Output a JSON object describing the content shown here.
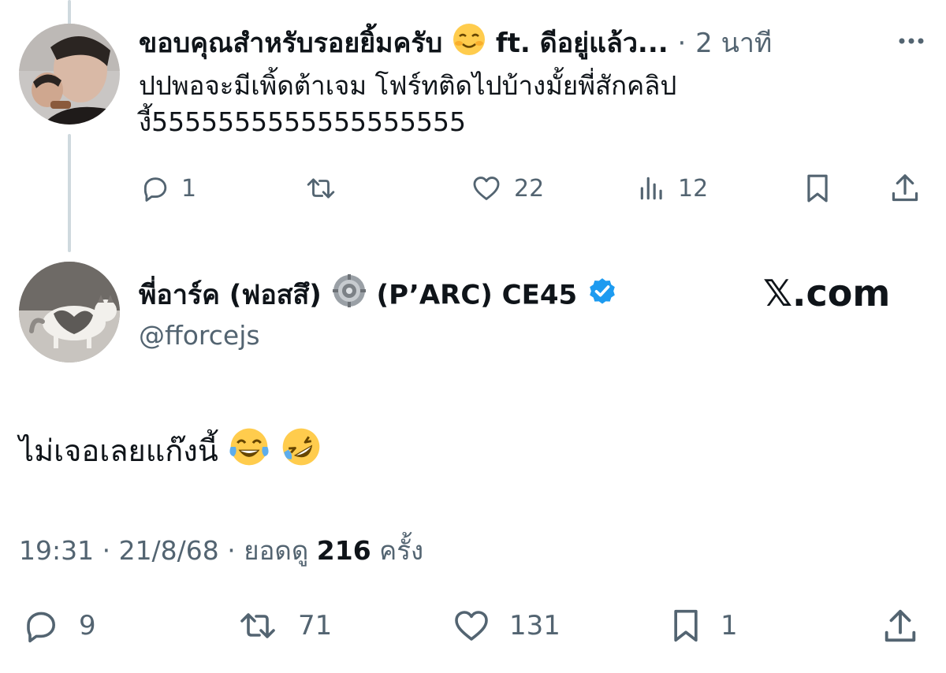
{
  "reply_tweet": {
    "display_name": "ขอบคุณสำหรับรอยยิ้มครับ",
    "name_suffix": "ft. ดีอยู่แล้ว...",
    "separator": "·",
    "time_ago": "2 นาที",
    "more_icon": "more-icon",
    "text_line1": "ปปพอจะมีเพิ้ดต้าเจม โฟร์ทติดไปบ้างมั้ยพี่สักคลิป",
    "text_line2": "งี้5555555555555555555",
    "actions": {
      "replies": "1",
      "reposts": "",
      "likes": "22",
      "views": "12"
    }
  },
  "main_tweet": {
    "display_name_part1": "พี่อาร์ค (ฟอสสึ)",
    "display_name_part2": "(P’ARC) CE45",
    "handle": "@fforcejs",
    "watermark": "𝕏.com",
    "text": "ไม่เจอเลยแก๊งนี้",
    "timestamp": "19:31 · 21/8/68 · ยอดดู",
    "view_count": "216",
    "view_unit": "ครั้ง",
    "actions": {
      "replies": "9",
      "reposts": "71",
      "likes": "131",
      "bookmarks": "1"
    }
  },
  "colors": {
    "text_primary": "#0f1419",
    "text_secondary": "#536471",
    "verified_blue": "#1d9bf0",
    "thread_line": "#cfd9de"
  }
}
